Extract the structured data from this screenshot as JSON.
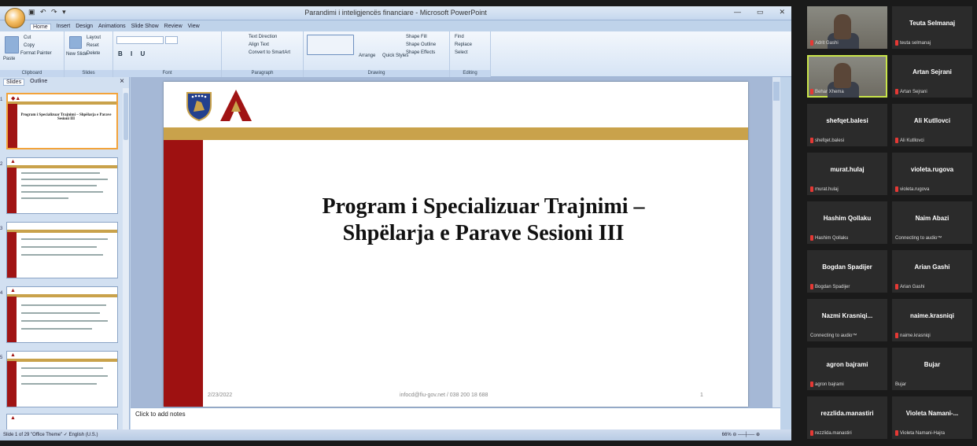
{
  "window": {
    "title": "Parandimi i inteligjencës financiare - Microsoft PowerPoint",
    "qat": "▣ ↶ ↷ ▾",
    "controls": [
      "—",
      "▭",
      "✕"
    ]
  },
  "ribbon": {
    "tabs": [
      "Home",
      "Insert",
      "Design",
      "Animations",
      "Slide Show",
      "Review",
      "View"
    ],
    "groups": [
      "Clipboard",
      "Slides",
      "Font",
      "Paragraph",
      "Drawing",
      "Editing"
    ],
    "clipboard": {
      "paste": "Paste",
      "cut": "Cut",
      "copy": "Copy",
      "format_painter": "Format Painter"
    },
    "slides": {
      "new_slide": "New Slide",
      "layout": "Layout",
      "reset": "Reset",
      "delete": "Delete"
    },
    "paragraph": {
      "text_direction": "Text Direction",
      "align_text": "Align Text",
      "convert_smartart": "Convert to SmartArt"
    },
    "drawing": {
      "arrange": "Arrange",
      "quick_styles": "Quick Styles",
      "shape_fill": "Shape Fill",
      "shape_outline": "Shape Outline",
      "shape_effects": "Shape Effects"
    },
    "editing": {
      "find": "Find",
      "replace": "Replace",
      "select": "Select"
    }
  },
  "left_pane": {
    "tabs": [
      "Slides",
      "Outline"
    ],
    "close": "×",
    "thumb1_title": "Program i Specializuar Trajnimi – Shpëlarja e Parave Sesioni III"
  },
  "slide": {
    "title_line1": "Program i Specializuar Trajnimi –",
    "title_line2": "Shpëlarja e Parave Sesioni III",
    "footer_date": "2/23/2022",
    "footer_center": "infocd@fiu-gov.net / 038 200 18 688",
    "footer_number": "1"
  },
  "notes": {
    "placeholder": "Click to add notes"
  },
  "status": {
    "left": "Slide 1 of 29   \"Office Theme\"   ✓ English (U.S.)",
    "zoom": "66% ⊖ ──┼── ⊕"
  },
  "participants": [
    {
      "name": "",
      "label": "Adrit Gashi",
      "video": true
    },
    {
      "name": "Teuta Selmanaj",
      "label": "teuta selmanaj"
    },
    {
      "name": "",
      "label": "Behar Xhema",
      "video": true,
      "active": true
    },
    {
      "name": "Artan Sejrani",
      "label": "Artan Sejrani"
    },
    {
      "name": "shefqet.balesi",
      "label": "shefqet.balesi"
    },
    {
      "name": "Ali Kutllovci",
      "label": "Ali Kutllovci"
    },
    {
      "name": "murat.hulaj",
      "label": "murat.hulaj"
    },
    {
      "name": "violeta.rugova",
      "label": "violeta.rugova"
    },
    {
      "name": "Hashim Qollaku",
      "label": "Hashim Qollaku"
    },
    {
      "name": "Naim Abazi",
      "label": "Connecting to audio™",
      "nomic": true
    },
    {
      "name": "Bogdan Spadijer",
      "label": "Bogdan Spadijer"
    },
    {
      "name": "Arian Gashi",
      "label": "Arian Gashi"
    },
    {
      "name": "Nazmi Krasniqi...",
      "label": "Connecting to audio™",
      "nomic": true
    },
    {
      "name": "naime.krasniqi",
      "label": "naime.krasniqi"
    },
    {
      "name": "agron bajrami",
      "label": "agron bajrami"
    },
    {
      "name": "Bujar",
      "label": "Bujar",
      "nomic": true
    },
    {
      "name": "rezzlida.manastiri",
      "label": "rezzlida.manastiri"
    },
    {
      "name": "Violeta Namani-...",
      "label": "Violeta Namani-Hajra"
    }
  ]
}
